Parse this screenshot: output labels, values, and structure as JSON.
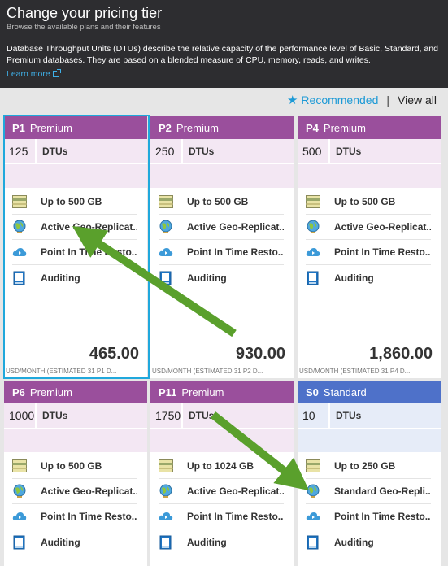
{
  "header": {
    "title": "Change your pricing tier",
    "subtitle": "Browse the available plans and their features",
    "description": "Database Throughput Units (DTUs) describe the relative capacity of the performance level of Basic, Standard, and Premium databases. They are based on a blended measure of CPU, memory, reads, and writes.",
    "learn_more": "Learn more"
  },
  "filter": {
    "recommended": "Recommended",
    "separator": "|",
    "view_all": "View all"
  },
  "cards": [
    {
      "code": "P1",
      "tier": "Premium",
      "dtus": "125",
      "dtu_label": "DTUs",
      "features": [
        "Up to 500 GB",
        "Active Geo-Replicat...",
        "Point In Time Resto...",
        "Auditing"
      ],
      "price": "465.00",
      "estimate": "USD/MONTH (ESTIMATED 31 P1 D..."
    },
    {
      "code": "P2",
      "tier": "Premium",
      "dtus": "250",
      "dtu_label": "DTUs",
      "features": [
        "Up to 500 GB",
        "Active Geo-Replicat...",
        "Point In Time Resto...",
        "Auditing"
      ],
      "price": "930.00",
      "estimate": "USD/MONTH (ESTIMATED 31 P2 D..."
    },
    {
      "code": "P4",
      "tier": "Premium",
      "dtus": "500",
      "dtu_label": "DTUs",
      "features": [
        "Up to 500 GB",
        "Active Geo-Replicat...",
        "Point In Time Resto...",
        "Auditing"
      ],
      "price": "1,860.00",
      "estimate": "USD/MONTH (ESTIMATED 31 P4 D..."
    },
    {
      "code": "P6",
      "tier": "Premium",
      "dtus": "1000",
      "dtu_label": "DTUs",
      "features": [
        "Up to 500 GB",
        "Active Geo-Replicat...",
        "Point In Time Resto...",
        "Auditing"
      ]
    },
    {
      "code": "P11",
      "tier": "Premium",
      "dtus": "1750",
      "dtu_label": "DTUs",
      "features": [
        "Up to 1024 GB",
        "Active Geo-Replicat...",
        "Point In Time Resto...",
        "Auditing"
      ]
    },
    {
      "code": "S0",
      "tier": "Standard",
      "dtus": "10",
      "dtu_label": "DTUs",
      "features": [
        "Up to 250 GB",
        "Standard Geo-Repli...",
        "Point In Time Resto...",
        "Auditing"
      ]
    }
  ],
  "colors": {
    "premium": "#9a4f9c",
    "standard": "#4e71c9",
    "selected": "#20a8dc",
    "arrow": "#5aa02c",
    "link": "#3fb0e8"
  }
}
